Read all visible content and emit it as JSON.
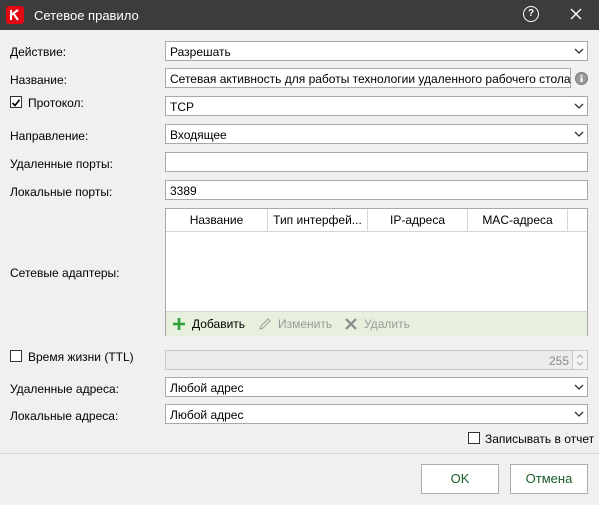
{
  "window": {
    "title": "Сетевое правило"
  },
  "form": {
    "action": {
      "label": "Действие:",
      "value": "Разрешать"
    },
    "name": {
      "label": "Название:",
      "value": "Сетевая активность для работы технологии удаленного рабочего стола"
    },
    "protocol": {
      "label": "Протокол:",
      "value": "TCP",
      "checked": true
    },
    "direction": {
      "label": "Направление:",
      "value": "Входящее"
    },
    "remote_ports": {
      "label": "Удаленные порты:",
      "value": ""
    },
    "local_ports": {
      "label": "Локальные порты:",
      "value": "3389"
    },
    "network_adapters": {
      "label": "Сетевые адаптеры:",
      "columns": [
        "Название",
        "Тип интерфей...",
        "IP-адреса",
        "MAC-адреса"
      ],
      "rows": [],
      "toolbar": {
        "add": "Добавить",
        "edit": "Изменить",
        "delete": "Удалить"
      }
    },
    "ttl": {
      "label": "Время жизни (TTL)",
      "checked": false,
      "value": "255"
    },
    "remote_addresses": {
      "label": "Удаленные адреса:",
      "value": "Любой адрес"
    },
    "local_addresses": {
      "label": "Локальные адреса:",
      "value": "Любой адрес"
    },
    "log": {
      "label": "Записывать в отчет",
      "checked": false
    }
  },
  "buttons": {
    "ok": "OK",
    "cancel": "Отмена"
  },
  "colors": {
    "titlebar": "#3c3c3c",
    "brand": "#e30613",
    "accent_green": "#1a5e2a",
    "toolbar_bg": "#e6f0dc"
  }
}
